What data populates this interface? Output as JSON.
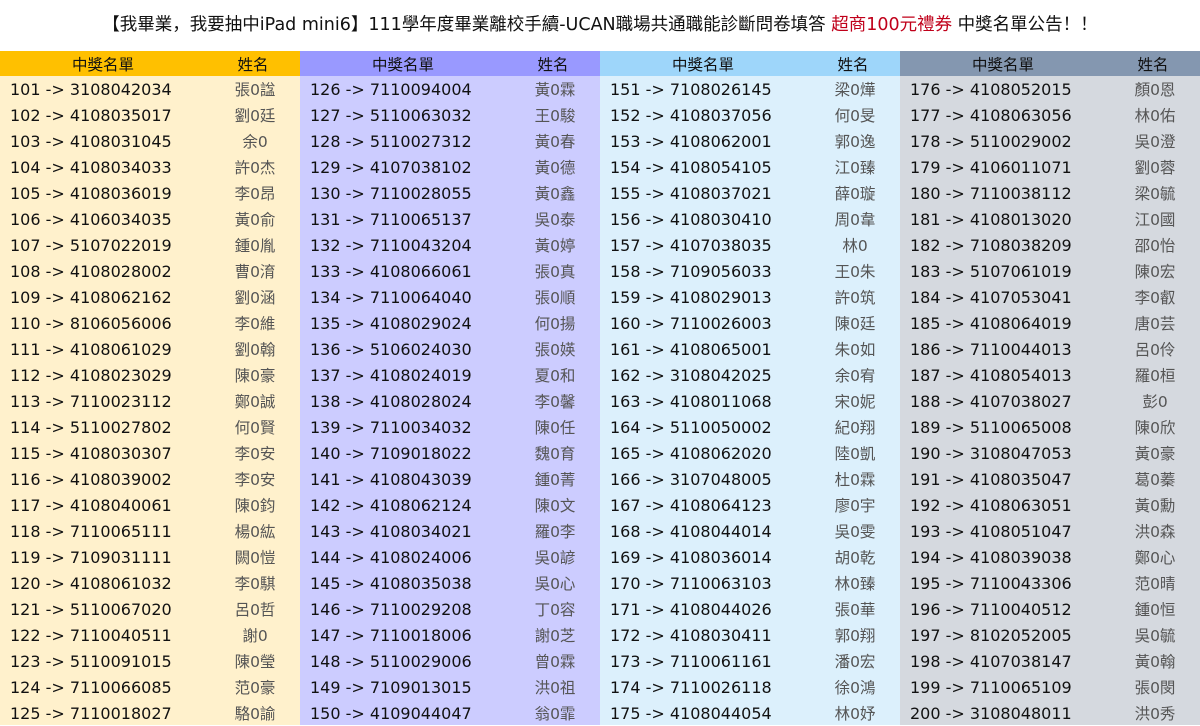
{
  "title": {
    "part1": "【我畢業，我要抽中iPad mini6】111學年度畢業離校手續-UCAN職場共通職能診斷問卷填答 ",
    "highlight": "超商100元禮券",
    "part2": " 中獎名單公告！！"
  },
  "colors": {
    "highlight": "#c0001a",
    "column_headers": [
      "#ffc000",
      "#9999ff",
      "#9ed6fa",
      "#8497b0"
    ],
    "column_bodies": [
      "#fff1cc",
      "#ccccff",
      "#dcf0fc",
      "#d5d9df"
    ]
  },
  "columns": [
    {
      "header_list": "中獎名單",
      "header_name": "姓名",
      "rows": [
        {
          "code": "101 -> 3108042034",
          "name": "張0諡"
        },
        {
          "code": "102 -> 4108035017",
          "name": "劉0廷"
        },
        {
          "code": "103 -> 4108031045",
          "name": "余0"
        },
        {
          "code": "104 -> 4108034033",
          "name": "許0杰"
        },
        {
          "code": "105 -> 4108036019",
          "name": "李0昂"
        },
        {
          "code": "106 -> 4106034035",
          "name": "黃0俞"
        },
        {
          "code": "107 -> 5107022019",
          "name": "鍾0胤"
        },
        {
          "code": "108 -> 4108028002",
          "name": "曹0淯"
        },
        {
          "code": "109 -> 4108062162",
          "name": "劉0涵"
        },
        {
          "code": "110 -> 8106056006",
          "name": "李0維"
        },
        {
          "code": "111 -> 4108061029",
          "name": "劉0翰"
        },
        {
          "code": "112 -> 4108023029",
          "name": "陳0豪"
        },
        {
          "code": "113 -> 7110023112",
          "name": "鄭0誠"
        },
        {
          "code": "114 -> 5110027802",
          "name": "何0賢"
        },
        {
          "code": "115 -> 4108030307",
          "name": "李0安"
        },
        {
          "code": "116 -> 4108039002",
          "name": "李0安"
        },
        {
          "code": "117 -> 4108040061",
          "name": "陳0鈞"
        },
        {
          "code": "118 -> 7110065111",
          "name": "楊0紘"
        },
        {
          "code": "119 -> 7109031111",
          "name": "闕0愷"
        },
        {
          "code": "120 -> 4108061032",
          "name": "李0騏"
        },
        {
          "code": "121 -> 5110067020",
          "name": "呂0哲"
        },
        {
          "code": "122 -> 7110040511",
          "name": "謝0"
        },
        {
          "code": "123 -> 5110091015",
          "name": "陳0瑩"
        },
        {
          "code": "124 -> 7110066085",
          "name": "范0豪"
        },
        {
          "code": "125 -> 7110018027",
          "name": "駱0諭"
        }
      ]
    },
    {
      "header_list": "中獎名單",
      "header_name": "姓名",
      "rows": [
        {
          "code": "126 -> 7110094004",
          "name": "黃0霖"
        },
        {
          "code": "127 -> 5110063032",
          "name": "王0駿"
        },
        {
          "code": "128 -> 5110027312",
          "name": "黃0春"
        },
        {
          "code": "129 -> 4107038102",
          "name": "黃0德"
        },
        {
          "code": "130 -> 7110028055",
          "name": "黃0鑫"
        },
        {
          "code": "131 -> 7110065137",
          "name": "吳0泰"
        },
        {
          "code": "132 -> 7110043204",
          "name": "黃0婷"
        },
        {
          "code": "133 -> 4108066061",
          "name": "張0真"
        },
        {
          "code": "134 -> 7110064040",
          "name": "張0順"
        },
        {
          "code": "135 -> 4108029024",
          "name": "何0揚"
        },
        {
          "code": "136 -> 5106024030",
          "name": "張0媖"
        },
        {
          "code": "137 -> 4108024019",
          "name": "夏0和"
        },
        {
          "code": "138 -> 4108028024",
          "name": "李0馨"
        },
        {
          "code": "139 -> 7110034032",
          "name": "陳0任"
        },
        {
          "code": "140 -> 7109018022",
          "name": "魏0育"
        },
        {
          "code": "141 -> 4108043039",
          "name": "鍾0菁"
        },
        {
          "code": "142 -> 4108062124",
          "name": "陳0文"
        },
        {
          "code": "143 -> 4108034021",
          "name": "羅0李"
        },
        {
          "code": "144 -> 4108024006",
          "name": "吳0諺"
        },
        {
          "code": "145 -> 4108035038",
          "name": "吳0心"
        },
        {
          "code": "146 -> 7110029208",
          "name": "丁0容"
        },
        {
          "code": "147 -> 7110018006",
          "name": "謝0芝"
        },
        {
          "code": "148 -> 5110029006",
          "name": "曾0霖"
        },
        {
          "code": "149 -> 7109013015",
          "name": "洪0祖"
        },
        {
          "code": "150 -> 4109044047",
          "name": "翁0霏"
        }
      ]
    },
    {
      "header_list": "中獎名單",
      "header_name": "姓名",
      "rows": [
        {
          "code": "151 -> 7108026145",
          "name": "梁0燁"
        },
        {
          "code": "152 -> 4108037056",
          "name": "何0旻"
        },
        {
          "code": "153 -> 4108062001",
          "name": "郭0逸"
        },
        {
          "code": "154 -> 4108054105",
          "name": "江0臻"
        },
        {
          "code": "155 -> 4108037021",
          "name": "薛0璇"
        },
        {
          "code": "156 -> 4108030410",
          "name": "周0韋"
        },
        {
          "code": "157 -> 4107038035",
          "name": "林0"
        },
        {
          "code": "158 -> 7109056033",
          "name": "王0朱"
        },
        {
          "code": "159 -> 4108029013",
          "name": "許0筑"
        },
        {
          "code": "160 -> 7110026003",
          "name": "陳0廷"
        },
        {
          "code": "161 -> 4108065001",
          "name": "朱0如"
        },
        {
          "code": "162 -> 3108042025",
          "name": "余0宥"
        },
        {
          "code": "163 -> 4108011068",
          "name": "宋0妮"
        },
        {
          "code": "164 -> 5110050002",
          "name": "紀0翔"
        },
        {
          "code": "165 -> 4108062020",
          "name": "陸0凱"
        },
        {
          "code": "166 -> 3107048005",
          "name": "杜0霖"
        },
        {
          "code": "167 -> 4108064123",
          "name": "廖0宇"
        },
        {
          "code": "168 -> 4108044014",
          "name": "吳0雯"
        },
        {
          "code": "169 -> 4108036014",
          "name": "胡0乾"
        },
        {
          "code": "170 -> 7110063103",
          "name": "林0臻"
        },
        {
          "code": "171 -> 4108044026",
          "name": "張0華"
        },
        {
          "code": "172 -> 4108030411",
          "name": "郭0翔"
        },
        {
          "code": "173 -> 7110061161",
          "name": "潘0宏"
        },
        {
          "code": "174 -> 7110026118",
          "name": "徐0鴻"
        },
        {
          "code": "175 -> 4108044054",
          "name": "林0妤"
        }
      ]
    },
    {
      "header_list": "中獎名單",
      "header_name": "姓名",
      "rows": [
        {
          "code": "176 -> 4108052015",
          "name": "顏0恩"
        },
        {
          "code": "177 -> 4108063056",
          "name": "林0佑"
        },
        {
          "code": "178 -> 5110029002",
          "name": "吳0澄"
        },
        {
          "code": "179 -> 4106011071",
          "name": "劉0蓉"
        },
        {
          "code": "180 -> 7110038112",
          "name": "梁0毓"
        },
        {
          "code": "181 -> 4108013020",
          "name": "江0國"
        },
        {
          "code": "182 -> 7108038209",
          "name": "邵0怡"
        },
        {
          "code": "183 -> 5107061019",
          "name": "陳0宏"
        },
        {
          "code": "184 -> 4107053041",
          "name": "李0叡"
        },
        {
          "code": "185 -> 4108064019",
          "name": "唐0芸"
        },
        {
          "code": "186 -> 7110044013",
          "name": "呂0伶"
        },
        {
          "code": "187 -> 4108054013",
          "name": "羅0桓"
        },
        {
          "code": "188 -> 4107038027",
          "name": "彭0"
        },
        {
          "code": "189 -> 5110065008",
          "name": "陳0欣"
        },
        {
          "code": "190 -> 3108047053",
          "name": "黃0豪"
        },
        {
          "code": "191 -> 4108035047",
          "name": "葛0蓁"
        },
        {
          "code": "192 -> 4108063051",
          "name": "黃0勳"
        },
        {
          "code": "193 -> 4108051047",
          "name": "洪0森"
        },
        {
          "code": "194 -> 4108039038",
          "name": "鄭0心"
        },
        {
          "code": "195 -> 7110043306",
          "name": "范0晴"
        },
        {
          "code": "196 -> 7110040512",
          "name": "鍾0恒"
        },
        {
          "code": "197 -> 8102052005",
          "name": "吳0毓"
        },
        {
          "code": "198 -> 4107038147",
          "name": "黃0翰"
        },
        {
          "code": "199 -> 7110065109",
          "name": "張0閔"
        },
        {
          "code": "200 -> 3108048011",
          "name": "洪0秀"
        }
      ]
    }
  ]
}
